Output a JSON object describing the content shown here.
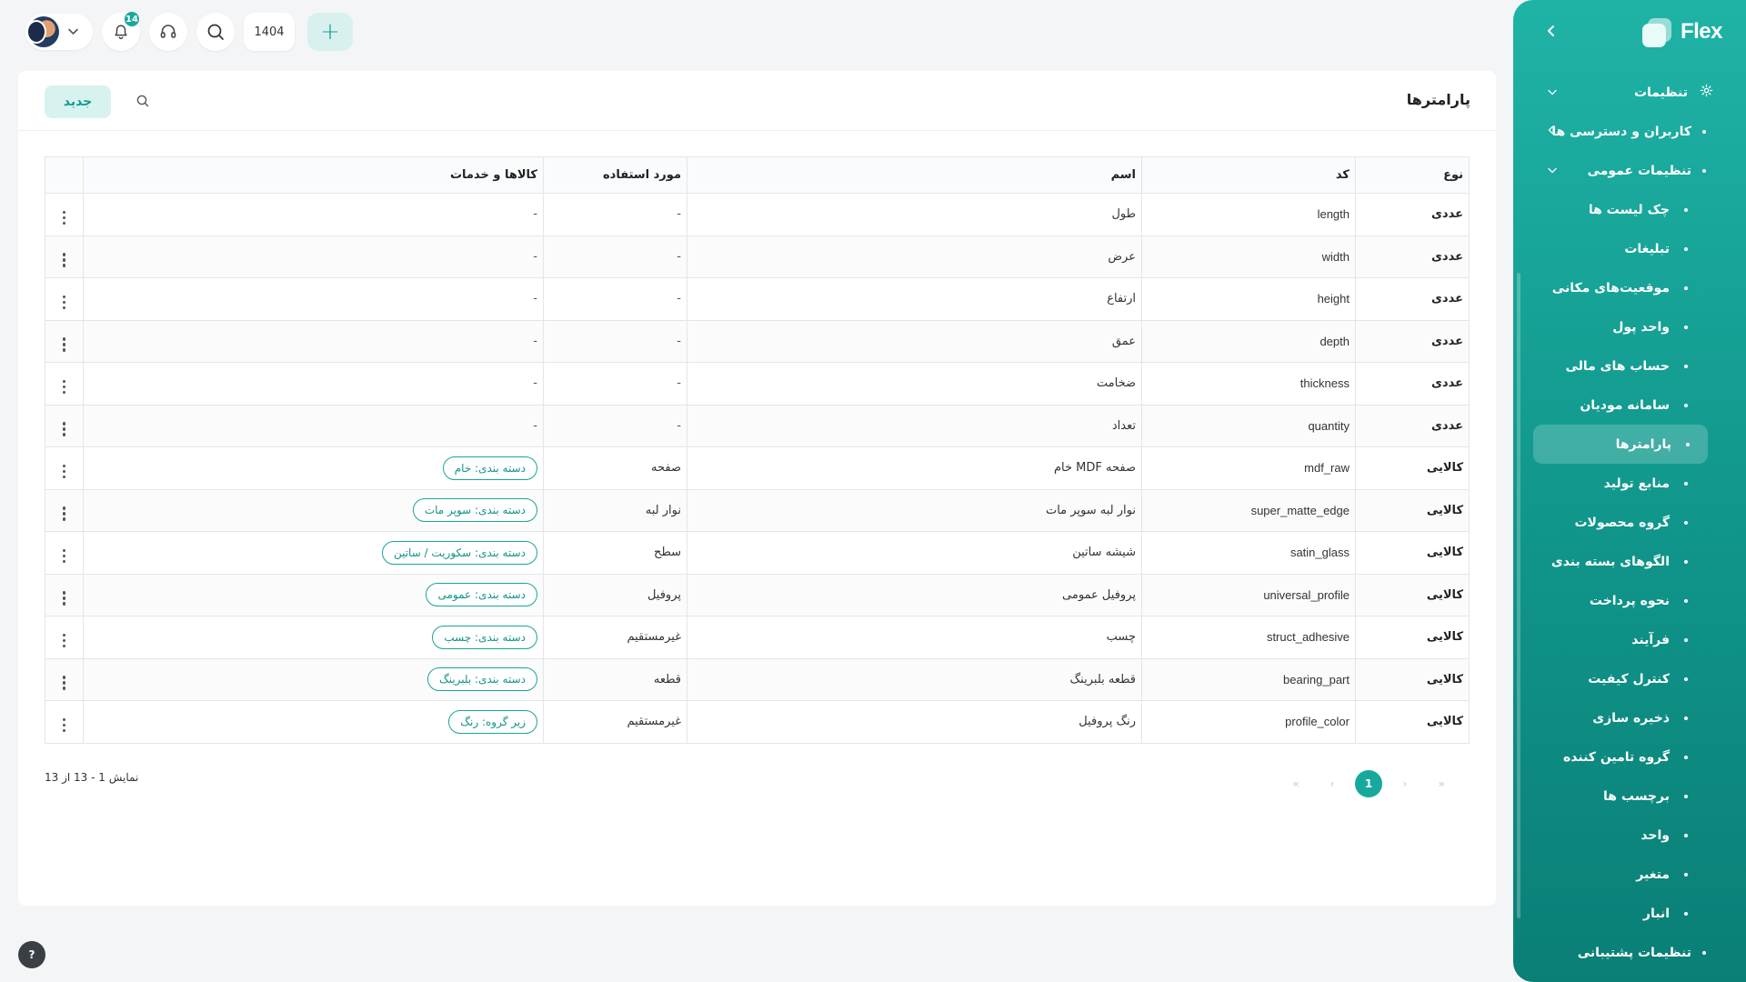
{
  "app": {
    "brand": "Flex",
    "colors": {
      "accent": "#17a99c",
      "sidebar_top": "#1fb3a6",
      "sidebar_bottom": "#0a7f76",
      "tag_border": "#1aa598"
    }
  },
  "topbar": {
    "notifications_count": "14",
    "year": "1404",
    "add_label": "+",
    "icons": {
      "notifications": "bell-icon",
      "support": "headset-icon",
      "search": "search-icon"
    }
  },
  "sidebar": {
    "collapse_icon": "chevron-left-icon",
    "items": [
      {
        "label": "تنظیمات",
        "level": 0,
        "icon": "gear-icon",
        "expanded": true
      },
      {
        "label": "کاربران و دسترسی ها",
        "level": 1,
        "expandable": true,
        "expanded": false
      },
      {
        "label": "تنظیمات عمومی",
        "level": 1,
        "expandable": true,
        "expanded": true
      },
      {
        "label": "چک لیست ها",
        "level": 2
      },
      {
        "label": "تبلیغات",
        "level": 2
      },
      {
        "label": "موقعیت‌های مکانی",
        "level": 2
      },
      {
        "label": "واحد پول",
        "level": 2
      },
      {
        "label": "حساب های مالی",
        "level": 2
      },
      {
        "label": "سامانه مودیان",
        "level": 2
      },
      {
        "label": "پارامترها",
        "level": 2,
        "active": true
      },
      {
        "label": "منابع تولید",
        "level": 2
      },
      {
        "label": "گروه محصولات",
        "level": 2
      },
      {
        "label": "الگوهای بسته بندی",
        "level": 2
      },
      {
        "label": "نحوه پرداخت",
        "level": 2
      },
      {
        "label": "فرآیند",
        "level": 2
      },
      {
        "label": "کنترل کیفیت",
        "level": 2
      },
      {
        "label": "ذخیره سازی",
        "level": 2
      },
      {
        "label": "گروه تامین کننده",
        "level": 2
      },
      {
        "label": "برچسب ها",
        "level": 2
      },
      {
        "label": "واحد",
        "level": 2
      },
      {
        "label": "متغیر",
        "level": 2
      },
      {
        "label": "انبار",
        "level": 2
      },
      {
        "label": "تنظیمات پشتیبانی",
        "level": 1
      }
    ]
  },
  "page": {
    "title": "پارامترها",
    "new_button": "جدید"
  },
  "table": {
    "columns": [
      "نوع",
      "کد",
      "اسم",
      "مورد استفاده",
      "کالاها و خدمات"
    ],
    "rows": [
      {
        "type": "عددی",
        "code": "length",
        "name": "طول",
        "usage": "-",
        "goods": "-"
      },
      {
        "type": "عددی",
        "code": "width",
        "name": "عرض",
        "usage": "-",
        "goods": "-"
      },
      {
        "type": "عددی",
        "code": "height",
        "name": "ارتفاع",
        "usage": "-",
        "goods": "-"
      },
      {
        "type": "عددی",
        "code": "depth",
        "name": "عمق",
        "usage": "-",
        "goods": "-"
      },
      {
        "type": "عددی",
        "code": "thickness",
        "name": "ضخامت",
        "usage": "-",
        "goods": "-"
      },
      {
        "type": "عددی",
        "code": "quantity",
        "name": "تعداد",
        "usage": "-",
        "goods": "-"
      },
      {
        "type": "کالایی",
        "code": "mdf_raw",
        "name": "صفحه MDF خام",
        "usage": "صفحه",
        "tag": "دسته بندی: خام"
      },
      {
        "type": "کالایی",
        "code": "super_matte_edge",
        "name": "نوار لبه سوپر مات",
        "usage": "نوار لبه",
        "tag": "دسته بندی: سوپر مات"
      },
      {
        "type": "کالایی",
        "code": "satin_glass",
        "name": "شیشه ساتین",
        "usage": "سطح",
        "tag": "دسته بندی: سکوریت / ساتین"
      },
      {
        "type": "کالایی",
        "code": "universal_profile",
        "name": "پروفیل عمومی",
        "usage": "پروفیل",
        "tag": "دسته بندی: عمومی"
      },
      {
        "type": "کالایی",
        "code": "struct_adhesive",
        "name": "چسب",
        "usage": "غیرمستقیم",
        "tag": "دسته بندی: چسب"
      },
      {
        "type": "کالایی",
        "code": "bearing_part",
        "name": "قطعه بلبرینگ",
        "usage": "قطعه",
        "tag": "دسته بندی: بلبرینگ"
      },
      {
        "type": "کالایی",
        "code": "profile_color",
        "name": "رنگ پروفیل",
        "usage": "غیرمستقیم",
        "tag": "زیر گروه: رنگ"
      }
    ]
  },
  "pagination": {
    "summary": "نمایش 1 - 13 از 13",
    "current_page": "1",
    "first": "«",
    "prev": "‹",
    "next": "›",
    "last": "»"
  },
  "help": {
    "label": "?"
  }
}
